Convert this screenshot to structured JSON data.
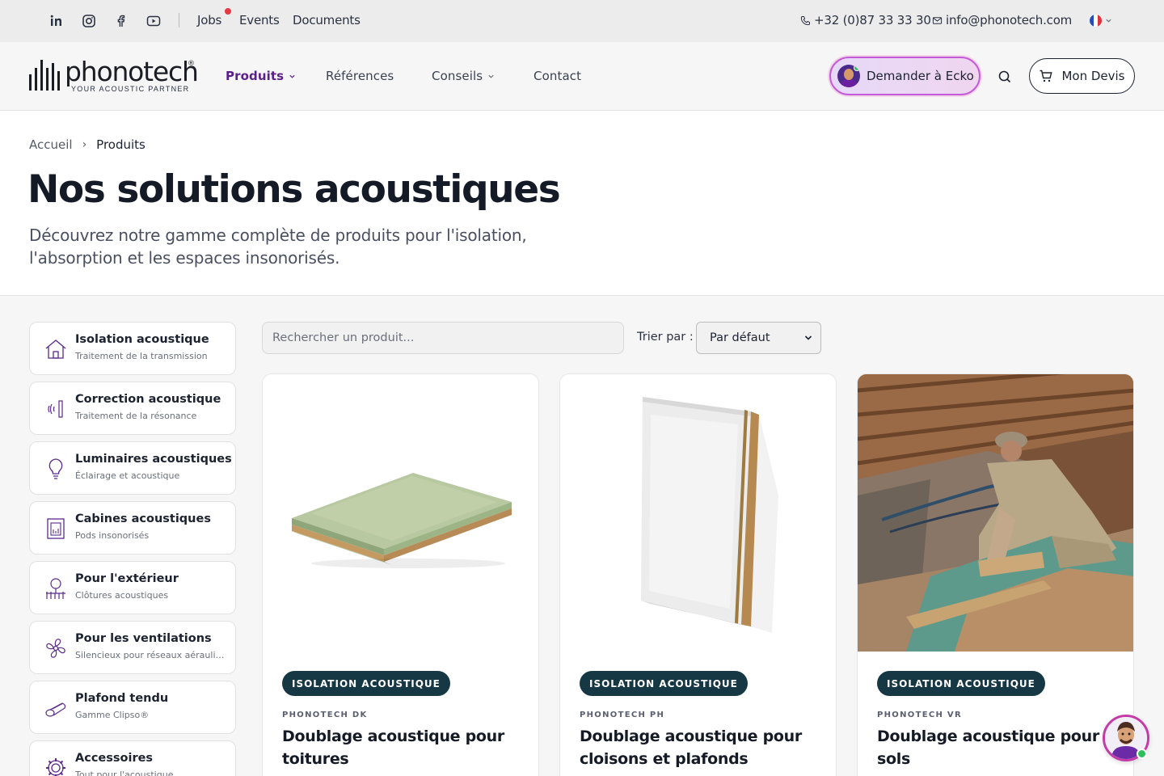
{
  "topbar": {
    "social_icons": [
      "linkedin-icon",
      "instagram-icon",
      "facebook-icon",
      "youtube-icon"
    ],
    "links": [
      "Jobs",
      "Events",
      "Documents"
    ],
    "phone": "+32 (0)87 33 33 30",
    "email": "info@phonotech.com",
    "language_flag": "fr-flag-icon"
  },
  "nav": {
    "logo_text": "phonotech",
    "logo_tagline": "YOUR ACOUSTIC PARTNER",
    "items": [
      {
        "label": "Produits",
        "active": true,
        "dropdown": true
      },
      {
        "label": "Références",
        "active": false,
        "dropdown": false
      },
      {
        "label": "Conseils",
        "active": false,
        "dropdown": true
      },
      {
        "label": "Contact",
        "active": false,
        "dropdown": false
      }
    ],
    "ask_button": "Demander à Ecko",
    "devis_button": "Mon Devis"
  },
  "hero": {
    "breadcrumb": {
      "home": "Accueil",
      "separator": "›",
      "current": "Produits"
    },
    "title": "Nos solutions acoustiques",
    "subtitle": "Découvrez notre gamme complète de produits pour l'isolation, l'absorption et les espaces insonorisés."
  },
  "categories": [
    {
      "title": "Isolation acoustique",
      "subtitle": "Traitement de la transmission",
      "icon": "house-icon"
    },
    {
      "title": "Correction acoustique",
      "subtitle": "Traitement de la résonance",
      "icon": "sound-waves-icon"
    },
    {
      "title": "Luminaires acoustiques",
      "subtitle": "Éclairage et acoustique",
      "icon": "lightbulb-icon"
    },
    {
      "title": "Cabines acoustiques",
      "subtitle": "Pods insonorisés",
      "icon": "booth-icon"
    },
    {
      "title": "Pour l'extérieur",
      "subtitle": "Clôtures acoustiques",
      "icon": "tree-fence-icon"
    },
    {
      "title": "Pour les ventilations",
      "subtitle": "Silencieux pour réseaux aérauliques",
      "icon": "fan-icon"
    },
    {
      "title": "Plafond tendu",
      "subtitle": "Gamme Clipso®",
      "icon": "roll-icon"
    },
    {
      "title": "Accessoires",
      "subtitle": "Tout pour l'acoustique",
      "icon": "gear-icon"
    }
  ],
  "toolbar": {
    "search_placeholder": "Rechercher un produit...",
    "sort_label": "Trier par :",
    "sort_value": "Par défaut"
  },
  "products": [
    {
      "badge": "ISOLATION ACOUSTIQUE",
      "sku": "PHONOTECH DK",
      "title": "Doublage acoustique pour toitures",
      "image": "panel-flat"
    },
    {
      "badge": "ISOLATION ACOUSTIQUE",
      "sku": "PHONOTECH PH",
      "title": "Doublage acoustique pour cloisons et plafonds",
      "image": "panel-standing"
    },
    {
      "badge": "ISOLATION ACOUSTIQUE",
      "sku": "PHONOTECH VR",
      "title": "Doublage acoustique pour sols",
      "image": "floor-install-photo"
    }
  ],
  "colors": {
    "brand_purple": "#5b1f8c",
    "badge_teal": "#163744",
    "accent_pink": "#c55ad8"
  }
}
